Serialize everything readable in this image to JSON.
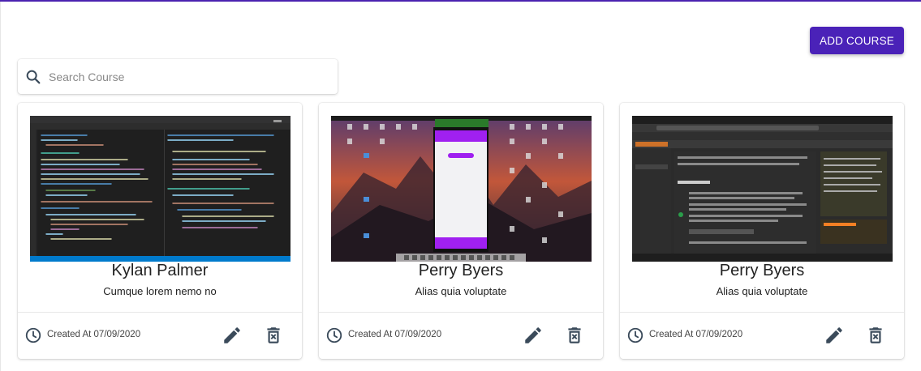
{
  "header": {
    "add_course_label": "ADD COURSE"
  },
  "search": {
    "placeholder": "Search Course",
    "value": ""
  },
  "colors": {
    "accent": "#4a22b8",
    "icon": "#3a4a5a"
  },
  "courses": [
    {
      "title": "Kylan Palmer",
      "description": "Cumque lorem nemo no",
      "created": "Created At 07/09/2020",
      "thumbnail": "code-editor-screenshot"
    },
    {
      "title": "Perry Byers",
      "description": "Alias quia voluptate",
      "created": "Created At 07/09/2020",
      "thumbnail": "desktop-mobile-emulator-screenshot"
    },
    {
      "title": "Perry Byers",
      "description": "Alias quia voluptate",
      "created": "Created At 07/09/2020",
      "thumbnail": "stackoverflow-browser-screenshot"
    }
  ]
}
